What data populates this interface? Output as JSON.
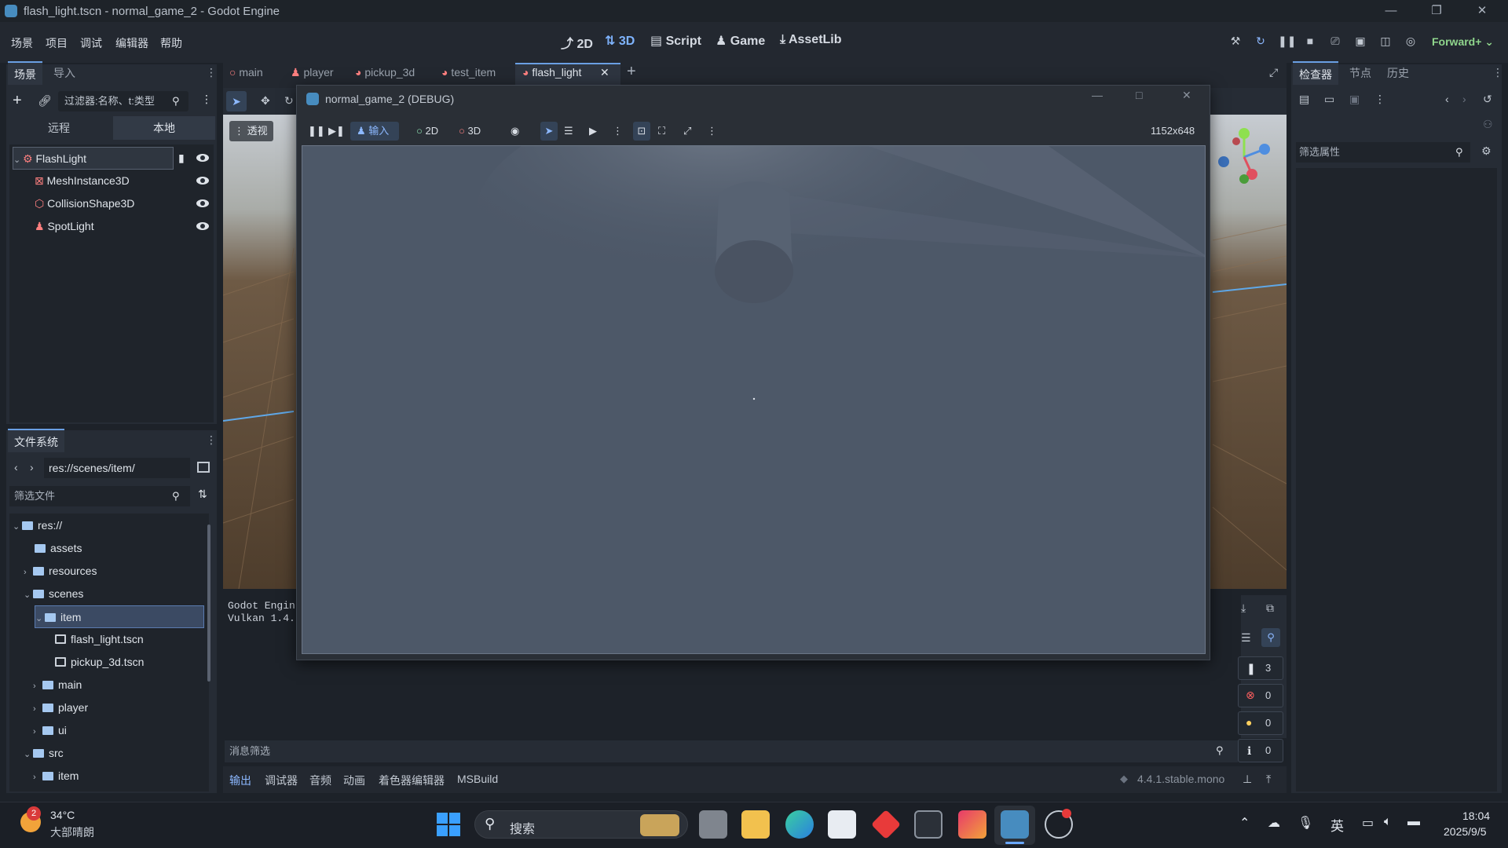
{
  "window": {
    "title": "flash_light.tscn - normal_game_2 - Godot Engine"
  },
  "menu": [
    "场景",
    "项目",
    "调试",
    "编辑器",
    "帮助"
  ],
  "workspaces": [
    {
      "label": "2D",
      "icon": "2d-icon"
    },
    {
      "label": "3D",
      "icon": "3d-icon",
      "active": true
    },
    {
      "label": "Script",
      "icon": "script-icon"
    },
    {
      "label": "Game",
      "icon": "game-icon"
    },
    {
      "label": "AssetLib",
      "icon": "assetlib-icon"
    }
  ],
  "renderer": "Forward+",
  "scene_dock": {
    "tabs": [
      "场景",
      "导入"
    ],
    "filter_placeholder": "过滤器:名称、t:类型",
    "remote_local": [
      "远程",
      "本地"
    ],
    "nodes": [
      {
        "name": "FlashLight",
        "icon": "node3d-icon"
      },
      {
        "name": "MeshInstance3D",
        "icon": "mesh-icon"
      },
      {
        "name": "CollisionShape3D",
        "icon": "collision-icon"
      },
      {
        "name": "SpotLight",
        "icon": "spotlight-icon"
      }
    ]
  },
  "filesystem": {
    "title": "文件系统",
    "path": "res://scenes/item/",
    "filter_placeholder": "筛选文件",
    "items": [
      {
        "label": "res://",
        "type": "folder",
        "depth": 0,
        "expanded": true
      },
      {
        "label": "assets",
        "type": "folder",
        "depth": 1
      },
      {
        "label": "resources",
        "type": "folder",
        "depth": 1
      },
      {
        "label": "scenes",
        "type": "folder",
        "depth": 1,
        "expanded": true
      },
      {
        "label": "item",
        "type": "folder",
        "depth": 2,
        "expanded": true,
        "selected": true
      },
      {
        "label": "flash_light.tscn",
        "type": "file",
        "depth": 3
      },
      {
        "label": "pickup_3d.tscn",
        "type": "file",
        "depth": 3
      },
      {
        "label": "main",
        "type": "folder",
        "depth": 2
      },
      {
        "label": "player",
        "type": "folder",
        "depth": 2
      },
      {
        "label": "ui",
        "type": "folder",
        "depth": 2
      },
      {
        "label": "src",
        "type": "folder",
        "depth": 1,
        "expanded": true
      },
      {
        "label": "item",
        "type": "folder",
        "depth": 2
      }
    ]
  },
  "scene_tabs": [
    "main",
    "player",
    "pickup_3d",
    "test_item",
    "flash_light"
  ],
  "viewport": {
    "perspective_label": "透视"
  },
  "debug_window": {
    "title": "normal_game_2 (DEBUG)",
    "toolbar": {
      "input_label": "输入",
      "mode_2d": "2D",
      "mode_3d": "3D",
      "resolution": "1152x648"
    }
  },
  "inspector": {
    "tabs": [
      "检查器",
      "节点",
      "历史"
    ],
    "filter_placeholder": "筛选属性"
  },
  "output": {
    "lines": [
      "Godot Engin",
      "Vulkan 1.4."
    ],
    "filter_placeholder": "消息筛选",
    "counters": [
      {
        "icon": "message-icon",
        "value": "3",
        "color": "#e0e5ec"
      },
      {
        "icon": "error-icon",
        "value": "0",
        "color": "#ff5f5f"
      },
      {
        "icon": "warning-icon",
        "value": "0",
        "color": "#ffd05f"
      },
      {
        "icon": "info-icon",
        "value": "0",
        "color": "#e0e5ec"
      }
    ],
    "bottom_tabs": [
      "输出",
      "调试器",
      "音频",
      "动画",
      "着色器编辑器",
      "MSBuild"
    ],
    "version": "4.4.1.stable.mono"
  },
  "taskbar": {
    "weather_temp": "34°C",
    "weather_desc": "大部晴朗",
    "weather_badge": "2",
    "search_label": "搜索",
    "ime": "英",
    "time": "18:04",
    "date": "2025/9/5"
  }
}
